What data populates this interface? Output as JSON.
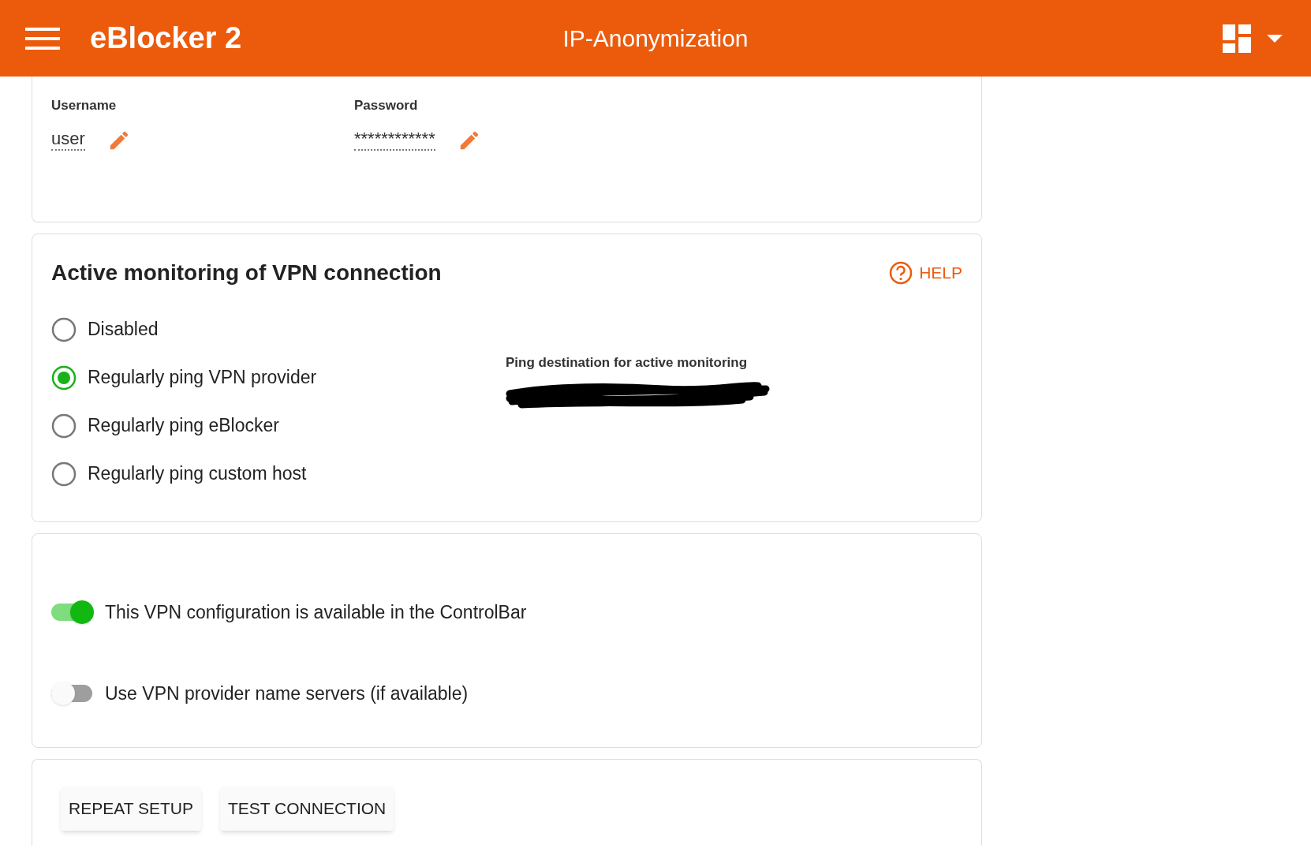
{
  "header": {
    "brand": "eBlocker 2",
    "title": "IP-Anonymization"
  },
  "credentials": [
    {
      "label": "Username",
      "value": "user"
    },
    {
      "label": "Password",
      "value": "************"
    }
  ],
  "monitoring": {
    "title": "Active monitoring of VPN connection",
    "help": "HELP",
    "destination_label": "Ping destination for active monitoring",
    "options": [
      {
        "label": "Disabled",
        "selected": false
      },
      {
        "label": "Regularly ping VPN provider",
        "selected": true
      },
      {
        "label": "Regularly ping eBlocker",
        "selected": false
      },
      {
        "label": "Regularly ping custom host",
        "selected": false
      }
    ]
  },
  "switches": [
    {
      "label": "This VPN configuration is available in the ControlBar",
      "on": true
    },
    {
      "label": "Use VPN provider name servers (if available)",
      "on": false
    }
  ],
  "buttons": [
    "REPEAT SETUP",
    "TEST CONNECTION"
  ]
}
